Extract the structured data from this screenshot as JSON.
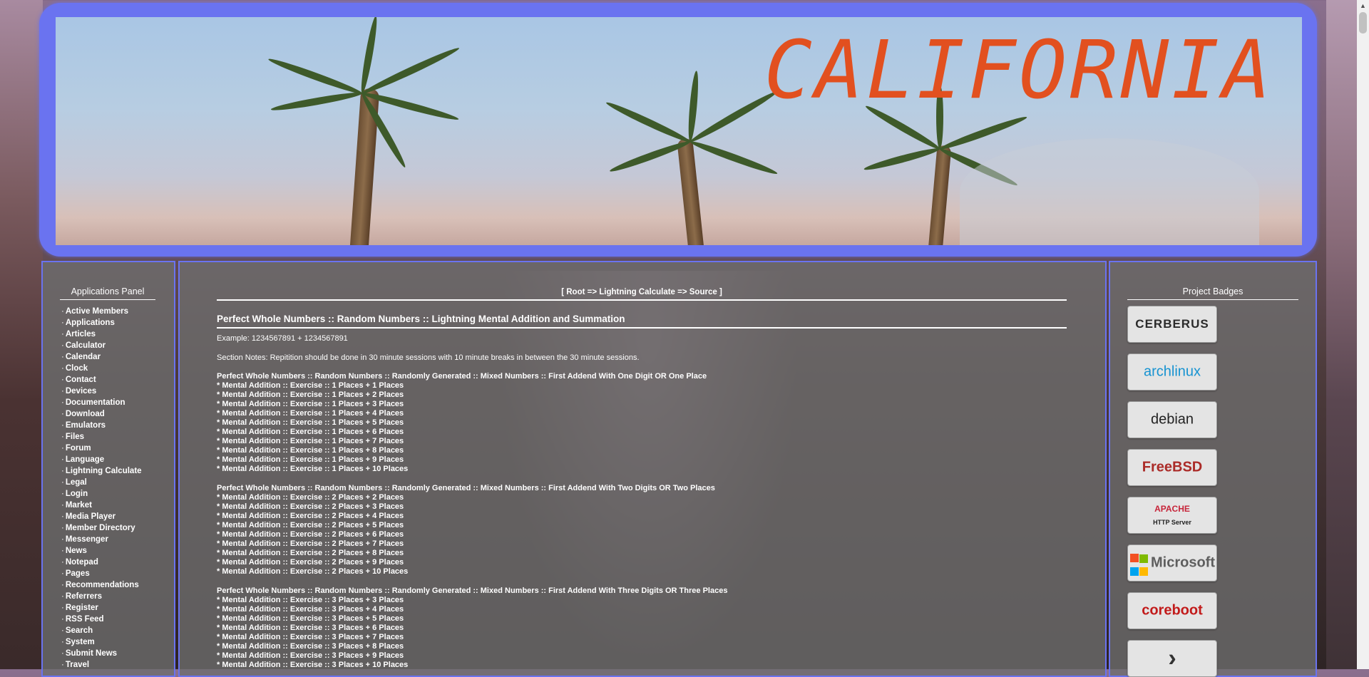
{
  "banner": {
    "title": "CALIFORNIA"
  },
  "left_panel": {
    "title": "Applications Panel",
    "items": [
      "Active Members",
      "Applications",
      "Articles",
      "Calculator",
      "Calendar",
      "Clock",
      "Contact",
      "Devices",
      "Documentation",
      "Download",
      "Emulators",
      "Files",
      "Forum",
      "Language",
      "Lightning Calculate",
      "Legal",
      "Login",
      "Market",
      "Media Player",
      "Member Directory",
      "Messenger",
      "News",
      "Notepad",
      "Pages",
      "Recommendations",
      "Referrers",
      "Register",
      "RSS Feed",
      "Search",
      "System",
      "Submit News",
      "Travel"
    ]
  },
  "breadcrumb": "[ Root => Lightning Calculate => Source ]",
  "content": {
    "title": "Perfect Whole Numbers :: Random Numbers :: Lightning Mental Addition and Summation",
    "example": "Example: 1234567891 + 1234567891",
    "notes": "Section Notes: Repitition should be done in 30 minute sessions with 10 minute breaks in between the 30 minute sessions.",
    "sections": [
      {
        "heading": "Perfect Whole Numbers :: Random Numbers :: Randomly Generated :: Mixed Numbers :: First Addend With One Digit OR One Place",
        "rows": [
          "* Mental Addition :: Exercise :: 1 Places + 1 Places",
          "* Mental Addition :: Exercise :: 1 Places + 2 Places",
          "* Mental Addition :: Exercise :: 1 Places + 3 Places",
          "* Mental Addition :: Exercise :: 1 Places + 4 Places",
          "* Mental Addition :: Exercise :: 1 Places + 5 Places",
          "* Mental Addition :: Exercise :: 1 Places + 6 Places",
          "* Mental Addition :: Exercise :: 1 Places + 7 Places",
          "* Mental Addition :: Exercise :: 1 Places + 8 Places",
          "* Mental Addition :: Exercise :: 1 Places + 9 Places",
          "* Mental Addition :: Exercise :: 1 Places + 10 Places"
        ]
      },
      {
        "heading": "Perfect Whole Numbers :: Random Numbers :: Randomly Generated :: Mixed Numbers :: First Addend With Two Digits OR Two Places",
        "rows": [
          "* Mental Addition :: Exercise :: 2 Places + 2 Places",
          "* Mental Addition :: Exercise :: 2 Places + 3 Places",
          "* Mental Addition :: Exercise :: 2 Places + 4 Places",
          "* Mental Addition :: Exercise :: 2 Places + 5 Places",
          "* Mental Addition :: Exercise :: 2 Places + 6 Places",
          "* Mental Addition :: Exercise :: 2 Places + 7 Places",
          "* Mental Addition :: Exercise :: 2 Places + 8 Places",
          "* Mental Addition :: Exercise :: 2 Places + 9 Places",
          "* Mental Addition :: Exercise :: 2 Places + 10 Places"
        ]
      },
      {
        "heading": "Perfect Whole Numbers :: Random Numbers :: Randomly Generated :: Mixed Numbers :: First Addend With Three Digits OR Three Places",
        "rows": [
          "* Mental Addition :: Exercise :: 3 Places + 3 Places",
          "* Mental Addition :: Exercise :: 3 Places + 4 Places",
          "* Mental Addition :: Exercise :: 3 Places + 5 Places",
          "* Mental Addition :: Exercise :: 3 Places + 6 Places",
          "* Mental Addition :: Exercise :: 3 Places + 7 Places",
          "* Mental Addition :: Exercise :: 3 Places + 8 Places",
          "* Mental Addition :: Exercise :: 3 Places + 9 Places",
          "* Mental Addition :: Exercise :: 3 Places + 10 Places"
        ]
      }
    ]
  },
  "right_panel": {
    "title": "Project Badges",
    "badges": [
      {
        "name": "cerberus",
        "label": "CERBERUS",
        "color": "#2b2b2b"
      },
      {
        "name": "archlinux",
        "label": "archlinux",
        "color": "#1793d1"
      },
      {
        "name": "debian",
        "label": "debian",
        "color": "#222222"
      },
      {
        "name": "freebsd",
        "label": "FreeBSD",
        "color": "#ab2b28"
      },
      {
        "name": "apache",
        "label": "APACHE",
        "sublabel": "HTTP Server",
        "color": "#c7253a"
      },
      {
        "name": "microsoft",
        "label": "Microsoft",
        "color": "#5e5e5e"
      },
      {
        "name": "coreboot",
        "label": "coreboot",
        "color": "#c21b1b"
      },
      {
        "name": "arrow-badge",
        "label": "",
        "color": "#333333"
      }
    ]
  }
}
